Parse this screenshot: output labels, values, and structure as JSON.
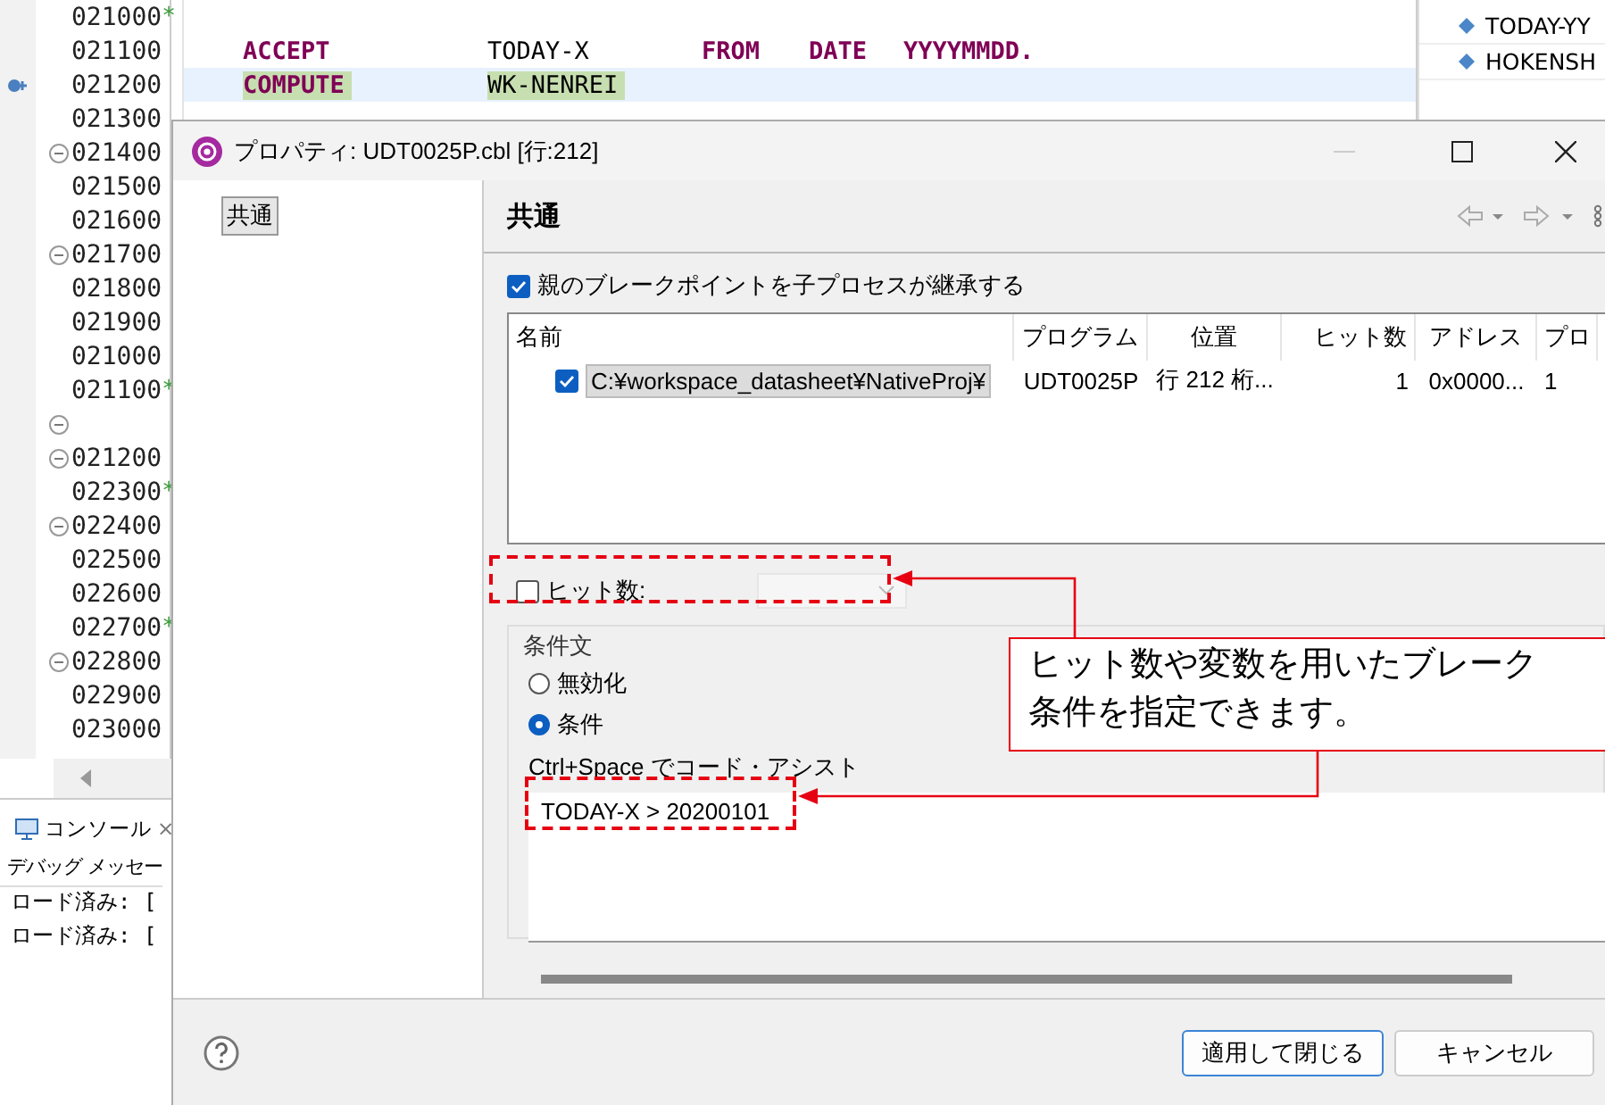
{
  "editor": {
    "lines": [
      {
        "number": "021000",
        "marker": "*"
      },
      {
        "number": "021100",
        "tokens": [
          {
            "text": "ACCEPT",
            "kind": "keyword",
            "highlighted": false
          },
          {
            "text": "TODAY-X",
            "kind": "identifier",
            "highlighted": false
          },
          {
            "text": "FROM",
            "kind": "keyword",
            "highlighted": false
          },
          {
            "text": "DATE",
            "kind": "keyword",
            "highlighted": false
          },
          {
            "text": "YYYYMMDD.",
            "kind": "keyword",
            "highlighted": false
          }
        ]
      },
      {
        "number": "021200",
        "breakpoint": true,
        "current": true,
        "tokens": [
          {
            "text": "COMPUTE",
            "kind": "keyword",
            "highlighted": true
          },
          {
            "text": "WK-NENREI",
            "kind": "identifier",
            "highlighted": true
          }
        ]
      },
      {
        "number": "021300"
      },
      {
        "number": "021400",
        "foldable": true
      },
      {
        "number": "021500"
      },
      {
        "number": "021600"
      },
      {
        "number": "021700",
        "foldable": true
      },
      {
        "number": "021800"
      },
      {
        "number": "021900"
      },
      {
        "number": "021000"
      },
      {
        "number": "021100",
        "marker": "*"
      },
      {
        "foldable": true
      },
      {
        "number": "021200",
        "foldable": true
      },
      {
        "number": "022300",
        "marker": "*"
      },
      {
        "number": "022400",
        "foldable": true
      },
      {
        "number": "022500"
      },
      {
        "number": "022600"
      },
      {
        "number": "022700",
        "marker": "*"
      },
      {
        "number": "022800",
        "foldable": true
      },
      {
        "number": "022900"
      },
      {
        "number": "023000"
      }
    ]
  },
  "outline": {
    "items": [
      {
        "label": "TODAY-YY"
      },
      {
        "label": "HOKENSH"
      }
    ]
  },
  "console": {
    "tab": "コンソール",
    "close": "×",
    "header": "デバッグ メッセー",
    "lines": [
      "ロード済み: [",
      "ロード済み: ["
    ]
  },
  "dialog": {
    "title": "プロパティ: UDT0025P.cbl [行:212]",
    "categories": [
      {
        "label": "共通",
        "selected": true
      }
    ],
    "page_title": "共通",
    "inherit": {
      "label": "親のブレークポイントを子プロセスが継承する",
      "checked": true
    },
    "table": {
      "columns": [
        "名前",
        "プログラム",
        "位置",
        "ヒット数",
        "アドレス",
        "プロ"
      ],
      "rows": [
        {
          "checked": true,
          "selected": true,
          "cells": [
            "C:¥workspace_datasheet¥NativeProj¥",
            "UDT0025P",
            "行 212 桁...",
            "1",
            "0x0000...",
            "1"
          ]
        }
      ]
    },
    "hit_count": {
      "label": "ヒット数:",
      "checked": false,
      "disabled": true
    },
    "condition": {
      "title": "条件文",
      "options": [
        {
          "label": "無効化",
          "selected": false
        },
        {
          "label": "条件",
          "selected": true
        }
      ],
      "hint": "Ctrl+Space でコード・アシスト",
      "value": "TODAY-X > 20200101"
    },
    "buttons": [
      {
        "label": "適用して閉じる",
        "default": true
      },
      {
        "label": "キャンセル",
        "default": false
      }
    ]
  },
  "callout": {
    "lines": [
      "ヒット数や変数を用いたブレーク",
      "条件を指定できます。"
    ]
  }
}
